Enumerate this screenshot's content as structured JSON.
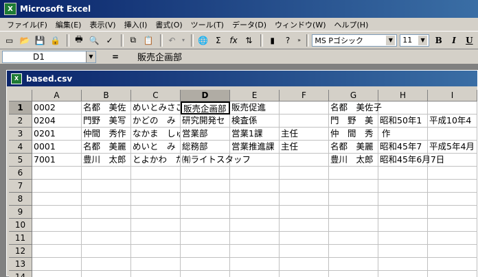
{
  "app_title": "Microsoft Excel",
  "menu": [
    "ファイル(F)",
    "編集(E)",
    "表示(V)",
    "挿入(I)",
    "書式(O)",
    "ツール(T)",
    "データ(D)",
    "ウィンドウ(W)",
    "ヘルプ(H)"
  ],
  "toolbar": {
    "font_name": "MS Pゴシック",
    "font_size": "11",
    "bold": "B",
    "italic": "I",
    "underline": "U",
    "sum": "Σ",
    "fx": "fx"
  },
  "formula_bar": {
    "name_box": "D1",
    "equals": "=",
    "content": "販売企画部"
  },
  "workbook": {
    "title": "based.csv",
    "columns": [
      "A",
      "B",
      "C",
      "D",
      "E",
      "F",
      "G",
      "H",
      "I"
    ],
    "rows": [
      "1",
      "2",
      "3",
      "4",
      "5",
      "6",
      "7",
      "8",
      "9",
      "10",
      "11",
      "12",
      "13",
      "14"
    ],
    "cells": [
      [
        "0002",
        "名都　美佐",
        "めいとみさこ",
        "販売企画部",
        "販売促進",
        "",
        "名都　美佐子",
        "",
        ""
      ],
      [
        "0204",
        "門野　美写",
        "かどの　み",
        "研究開発セ",
        "検査係",
        "",
        "門　野　美",
        "昭和50年1",
        "平成10年4"
      ],
      [
        "0201",
        "仲間　秀作",
        "なかま　しゅ",
        "営業部",
        "営業1課",
        "主任",
        "仲　間　秀　作",
        "",
        ""
      ],
      [
        "0001",
        "名都　美麗",
        "めいと　み",
        "総務部",
        "営業推進課",
        "主任",
        "名都　美麗",
        "昭和45年7",
        "平成5年4月"
      ],
      [
        "7001",
        "豊川　太郎",
        "とよかわ　た",
        "㈲ライトスタッフ",
        "",
        "",
        "豊川　太郎",
        "昭和45年6月7日",
        ""
      ]
    ],
    "active_cell": "D1"
  }
}
